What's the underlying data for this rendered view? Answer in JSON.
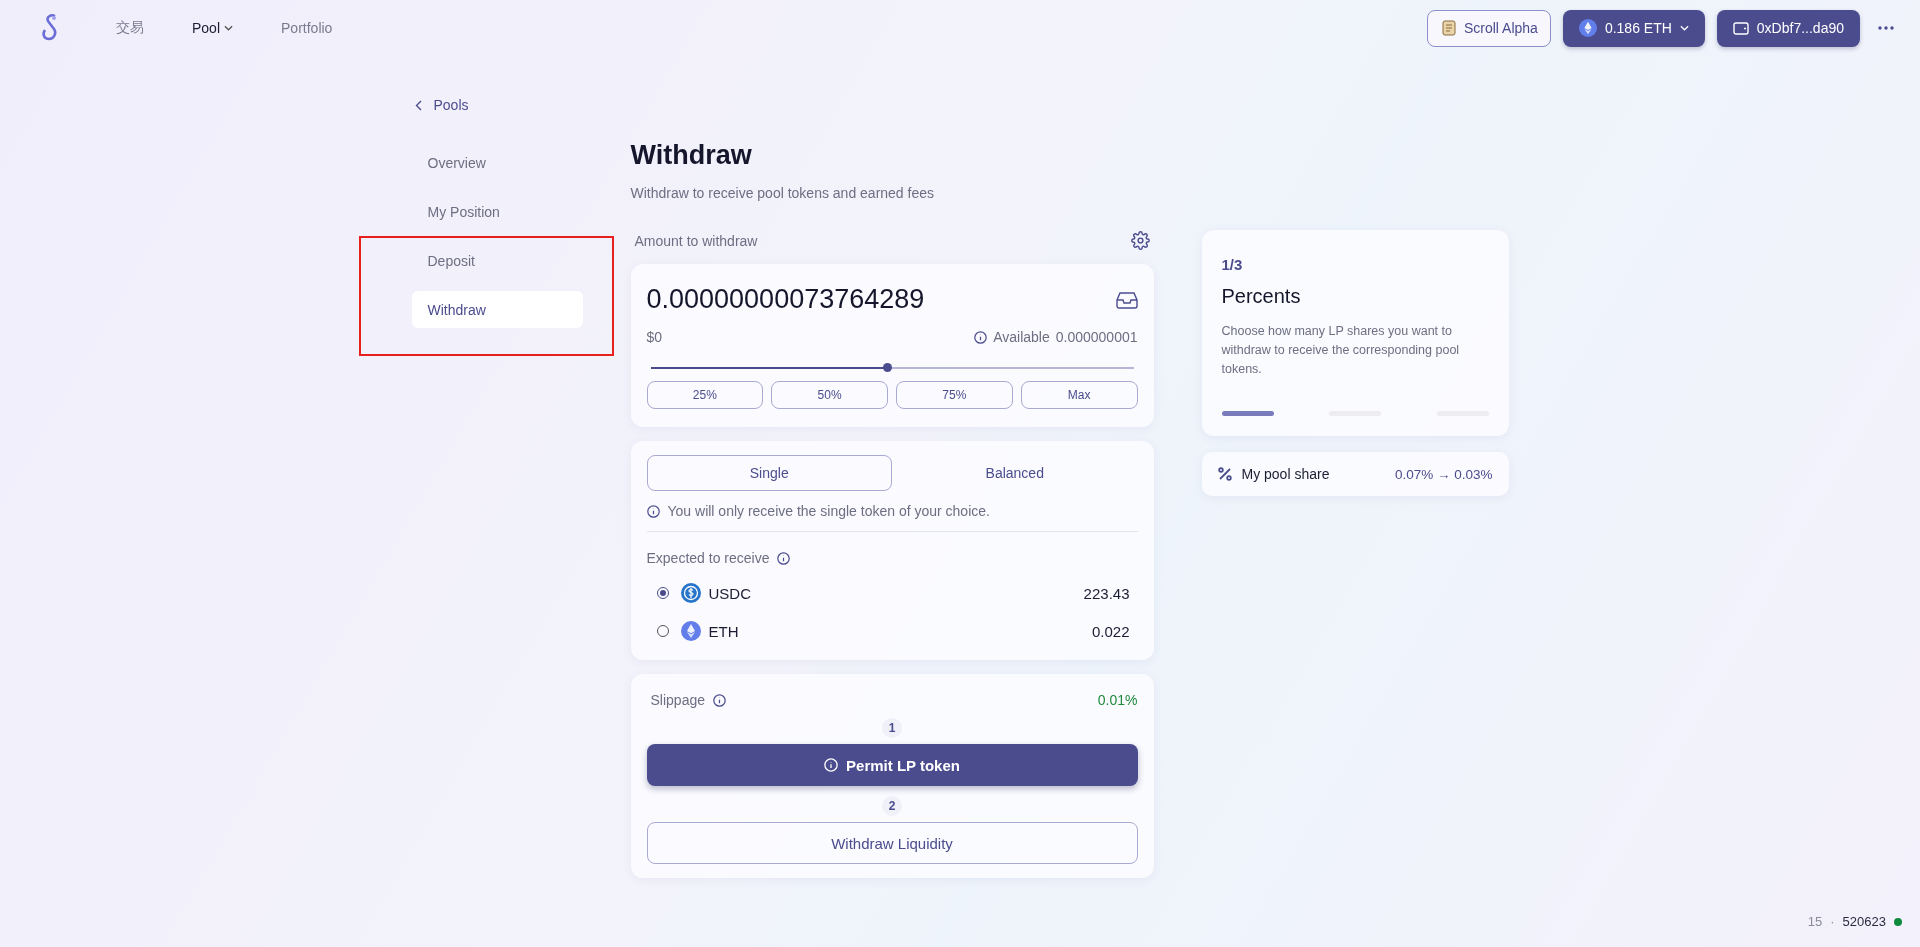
{
  "header": {
    "nav": [
      {
        "label": "交易",
        "selected": false,
        "has_caret": false
      },
      {
        "label": "Pool",
        "selected": true,
        "has_caret": true
      },
      {
        "label": "Portfolio",
        "selected": false,
        "has_caret": false
      }
    ],
    "network": "Scroll Alpha",
    "balance": "0.186",
    "balance_unit": "ETH",
    "wallet": "0xDbf7...da90"
  },
  "sidebar": {
    "back": "Pools",
    "items": [
      {
        "label": "Overview",
        "selected": false
      },
      {
        "label": "My Position",
        "selected": false
      },
      {
        "label": "Deposit",
        "selected": false
      },
      {
        "label": "Withdraw",
        "selected": true
      }
    ]
  },
  "main": {
    "title": "Withdraw",
    "subtitle": "Withdraw to receive pool tokens and earned fees",
    "amount_label": "Amount to withdraw",
    "amount": "0.00000000073764289",
    "usd": "$0",
    "available_label": "Available",
    "available": "0.000000001",
    "slider": {
      "level": 0.49
    },
    "presets": [
      "25%",
      "50%",
      "75%",
      "Max"
    ],
    "modes": [
      {
        "label": "Single",
        "selected": true
      },
      {
        "label": "Balanced",
        "selected": false
      }
    ],
    "mode_note": "You will only receive the single token of your choice.",
    "expected_label": "Expected to receive",
    "tokens": [
      {
        "kind": "usdc",
        "symbol": "USDC",
        "amount": "223.43",
        "selected": true
      },
      {
        "kind": "eth",
        "symbol": "ETH",
        "amount": "0.022",
        "selected": false
      }
    ],
    "slippage_label": "Slippage",
    "slippage": "0.01%",
    "steps": [
      {
        "number": "1",
        "label": "Permit LP token",
        "primary": true
      },
      {
        "number": "2",
        "label": "Withdraw Liquidity",
        "primary": false
      }
    ]
  },
  "guide": {
    "step": "1/3",
    "title": "Percents",
    "text": "Choose how many LP shares you want to withdraw to receive the corresponding pool tokens.",
    "progress": [
      {
        "selected": true
      },
      {
        "selected": false
      },
      {
        "selected": false
      }
    ]
  },
  "pool_share": {
    "label": "My pool share",
    "value": "0.07% → 0.03%"
  },
  "footer": {
    "count": "15",
    "separator": "·",
    "block": "520623",
    "color": "#0e8a3c"
  }
}
